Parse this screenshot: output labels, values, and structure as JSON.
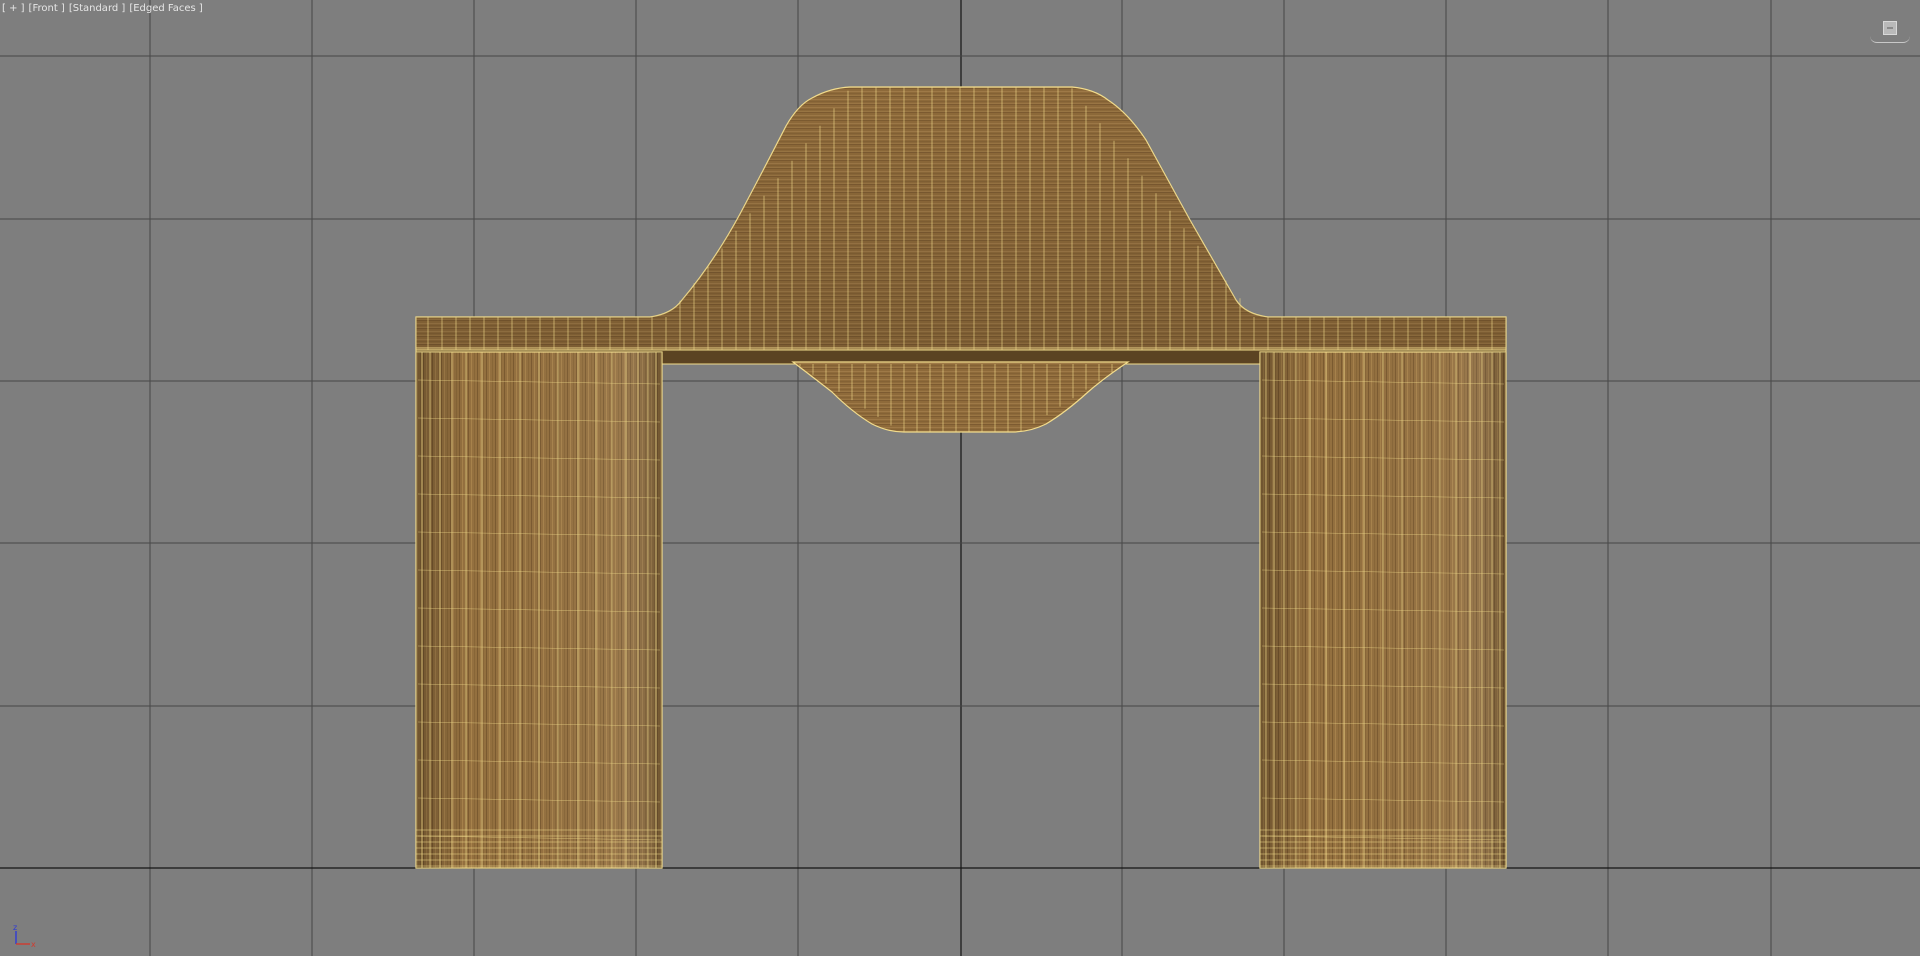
{
  "viewport": {
    "label": {
      "menu": "[ + ]",
      "view": "[Front ]",
      "shading_preset": "[Standard ]",
      "display_mode": "[Edged Faces ]"
    },
    "background_color": "#7e7e7e",
    "grid_color": "#474747",
    "world_axis_color": "#141414",
    "object": {
      "texture": "wood",
      "wire_color": "#f2dc8c",
      "wood_colors": [
        "#8b6738",
        "#a7814a",
        "#6b4c26",
        "#9a7340"
      ]
    },
    "viewcube": {
      "icon": "viewcube-icon"
    },
    "axis_tripod": {
      "icon": "axis-tripod-icon",
      "z_label": "z",
      "x_label": "x",
      "z_color": "#2e3ad6",
      "x_color": "#d23a2e"
    }
  }
}
